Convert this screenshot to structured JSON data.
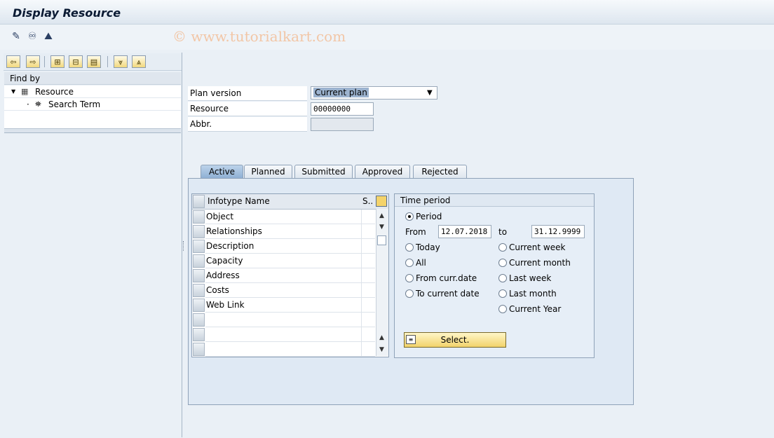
{
  "window": {
    "title": "Display Resource"
  },
  "watermark": "© www.tutorialkart.com",
  "toolbar": {
    "icons": [
      "edit-pencil-icon",
      "change-glasses-icon",
      "person-overview-icon"
    ]
  },
  "nav": {
    "find_by_label": "Find by",
    "tree": {
      "root_label": "Resource",
      "child_label": "Search Term"
    }
  },
  "form": {
    "plan_version_label": "Plan version",
    "plan_version_value": "Current plan",
    "resource_label": "Resource",
    "resource_value": "00000000",
    "abbr_label": "Abbr.",
    "abbr_value": ""
  },
  "tabs": [
    {
      "label": "Active",
      "selected": true
    },
    {
      "label": "Planned"
    },
    {
      "label": "Submitted"
    },
    {
      "label": "Approved"
    },
    {
      "label": "Rejected"
    }
  ],
  "infotype_table": {
    "col_name": "Infotype Name",
    "col_status": "S..",
    "rows": [
      "Object",
      "Relationships",
      "Description",
      "Capacity",
      "Address",
      "Costs",
      "Web Link"
    ]
  },
  "time_period": {
    "title": "Time period",
    "period_label": "Period",
    "from_label": "From",
    "from_value": "12.07.2018",
    "to_label": "to",
    "to_value": "31.12.9999",
    "left_options": [
      "Today",
      "All",
      "From curr.date",
      "To current date"
    ],
    "right_options": [
      "Current week",
      "Current month",
      "Last week",
      "Last month",
      "Current Year"
    ],
    "selected": "Period",
    "select_button": "Select."
  },
  "colors": {
    "accent": "#8fb0d4",
    "button_yellow": "#f2d36b"
  }
}
